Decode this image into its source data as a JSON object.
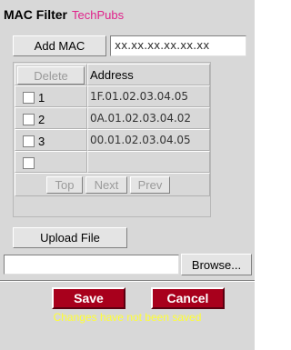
{
  "header": {
    "title": "MAC Filter",
    "subtitle": "TechPubs",
    "subtitle_color": "#e0218a"
  },
  "add": {
    "button_label": "Add MAC",
    "mac_input_value": "xx.xx.xx.xx.xx.xx"
  },
  "table": {
    "delete_label": "Delete",
    "address_header": "Address",
    "rows": [
      {
        "index": "1",
        "address": "1F.01.02.03.04.05"
      },
      {
        "index": "2",
        "address": "0A.01.02.03.04.02"
      },
      {
        "index": "3",
        "address": "00.01.02.03.04.05"
      },
      {
        "index": "",
        "address": ""
      }
    ],
    "nav": {
      "top": "Top",
      "next": "Next",
      "prev": "Prev"
    }
  },
  "upload": {
    "button_label": "Upload File",
    "file_value": "",
    "browse_label": "Browse..."
  },
  "actions": {
    "save_label": "Save",
    "cancel_label": "Cancel",
    "button_color": "#a8001c"
  },
  "notice": {
    "text": "Changes have not been saved",
    "color": "#ffff33"
  }
}
